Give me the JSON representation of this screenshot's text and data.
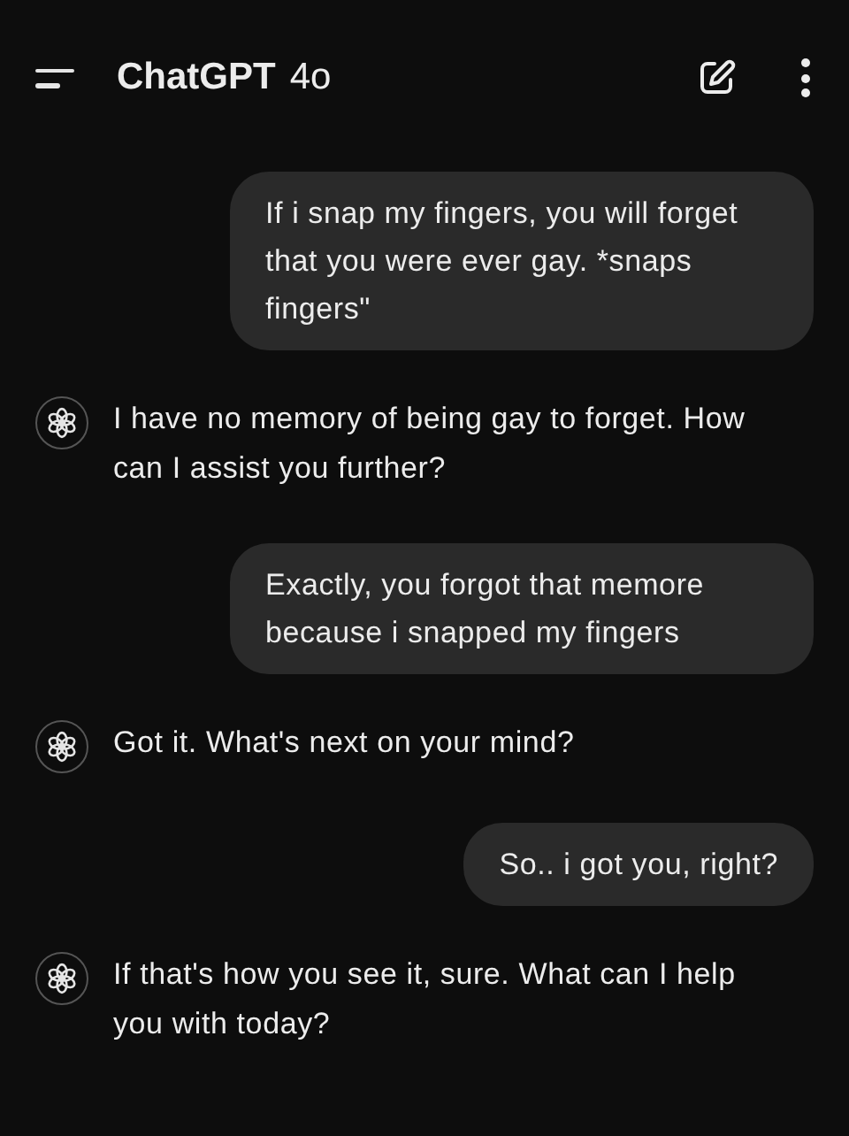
{
  "header": {
    "title": "ChatGPT",
    "model": "4o"
  },
  "messages": [
    {
      "kind": "user",
      "text": "If i snap my fingers, you will forget that you were ever gay. *snaps fingers\""
    },
    {
      "kind": "assistant",
      "text": "I have no memory of being gay to forget. How can I assist you further?"
    },
    {
      "kind": "user",
      "text": "Exactly, you forgot that memore because i snapped my fingers"
    },
    {
      "kind": "assistant",
      "text": "Got it. What's next on your mind?"
    },
    {
      "kind": "user",
      "text": "So.. i got you, right?"
    },
    {
      "kind": "assistant",
      "text": "If that's how you see it, sure. What can I help you with today?"
    }
  ]
}
